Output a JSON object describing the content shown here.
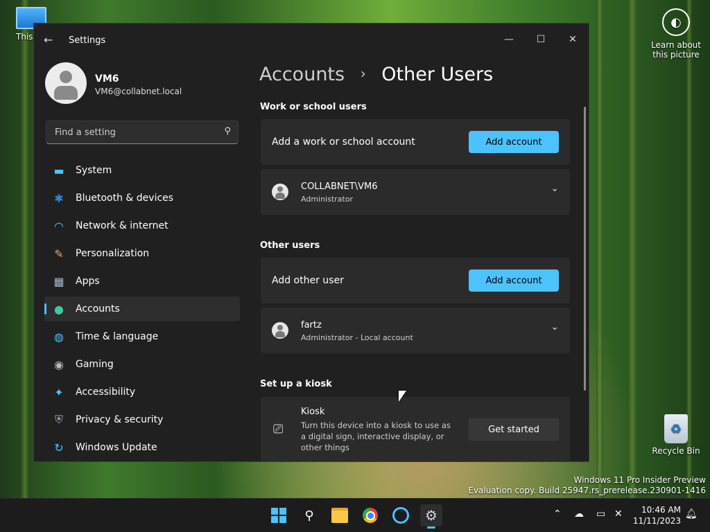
{
  "desktop": {
    "this_pc_label": "This PC",
    "learn_label": "Learn about this picture",
    "recycle_label": "Recycle Bin",
    "watermark_line1": "Windows 11 Pro Insider Preview",
    "watermark_line2": "Evaluation copy. Build 25947.rs_prerelease.230901-1416"
  },
  "window": {
    "title": "Settings",
    "minimize_glyph": "—",
    "maximize_glyph": "☐",
    "close_glyph": "✕",
    "back_glyph": "←"
  },
  "profile": {
    "name": "VM6",
    "email": "VM6@collabnet.local"
  },
  "search": {
    "placeholder": "Find a setting",
    "icon_glyph": "⚲"
  },
  "nav": {
    "items": [
      {
        "label": "System",
        "icon": "system-icon",
        "glyph": "▬",
        "color": "#4cc2ff"
      },
      {
        "label": "Bluetooth & devices",
        "icon": "bluetooth-icon",
        "glyph": "✱",
        "color": "#2f86d6"
      },
      {
        "label": "Network & internet",
        "icon": "wifi-icon",
        "glyph": "◠",
        "color": "#4cc2ff"
      },
      {
        "label": "Personalization",
        "icon": "brush-icon",
        "glyph": "✎",
        "color": "#e6a86a"
      },
      {
        "label": "Apps",
        "icon": "apps-icon",
        "glyph": "▦",
        "color": "#a9b8c8"
      },
      {
        "label": "Accounts",
        "icon": "accounts-icon",
        "glyph": "●",
        "color": "#3fc9a0"
      },
      {
        "label": "Time & language",
        "icon": "globe-icon",
        "glyph": "◍",
        "color": "#4cc2ff"
      },
      {
        "label": "Gaming",
        "icon": "gamepad-icon",
        "glyph": "◉",
        "color": "#b7b7b7"
      },
      {
        "label": "Accessibility",
        "icon": "accessibility-icon",
        "glyph": "✦",
        "color": "#4cc2ff"
      },
      {
        "label": "Privacy & security",
        "icon": "shield-icon",
        "glyph": "⛨",
        "color": "#9aa5b1"
      },
      {
        "label": "Windows Update",
        "icon": "update-icon",
        "glyph": "↻",
        "color": "#4cc2ff"
      }
    ],
    "active_index": 5
  },
  "main": {
    "breadcrumb_parent": "Accounts",
    "breadcrumb_sep": "›",
    "breadcrumb_current": "Other Users",
    "work_section": {
      "heading": "Work or school users",
      "add_text": "Add a work or school account",
      "add_button": "Add account",
      "user_name": "COLLABNET\\VM6",
      "user_role": "Administrator"
    },
    "other_section": {
      "heading": "Other users",
      "add_text": "Add other user",
      "add_button": "Add account",
      "user_name": "fartz",
      "user_role": "Administrator - Local account"
    },
    "kiosk_section": {
      "heading": "Set up a kiosk",
      "title": "Kiosk",
      "description": "Turn this device into a kiosk to use as a digital sign, interactive display, or other things",
      "button": "Get started"
    },
    "chevron_glyph": "⌄"
  },
  "taskbar": {
    "clock_time": "10:46 AM",
    "clock_date": "11/11/2023",
    "accent_color": "#4cc2ff"
  }
}
